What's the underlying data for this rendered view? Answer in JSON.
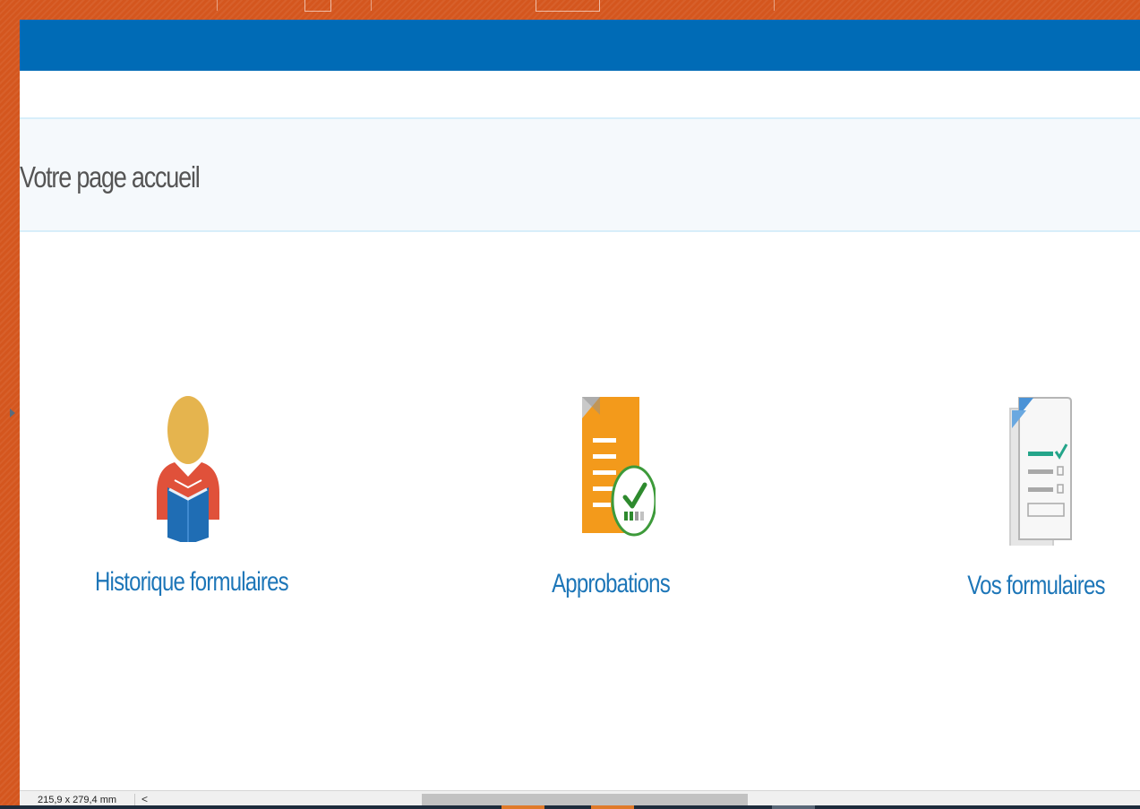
{
  "header": {
    "title": "Votre page accueil"
  },
  "tiles": [
    {
      "label": "Historique formulaires",
      "icon": "reader-person-icon"
    },
    {
      "label": "Approbations",
      "icon": "approved-document-icon"
    },
    {
      "label": "Vos formulaires",
      "icon": "checklist-form-icon"
    }
  ],
  "status_bar": {
    "paper_size": "215,9 x 279,4 mm",
    "scroll_left_glyph": "<"
  },
  "colors": {
    "header_blue": "#006bb6",
    "link_blue": "#1d76b8",
    "title_gray": "#555555",
    "band_border": "#d8eefa"
  }
}
